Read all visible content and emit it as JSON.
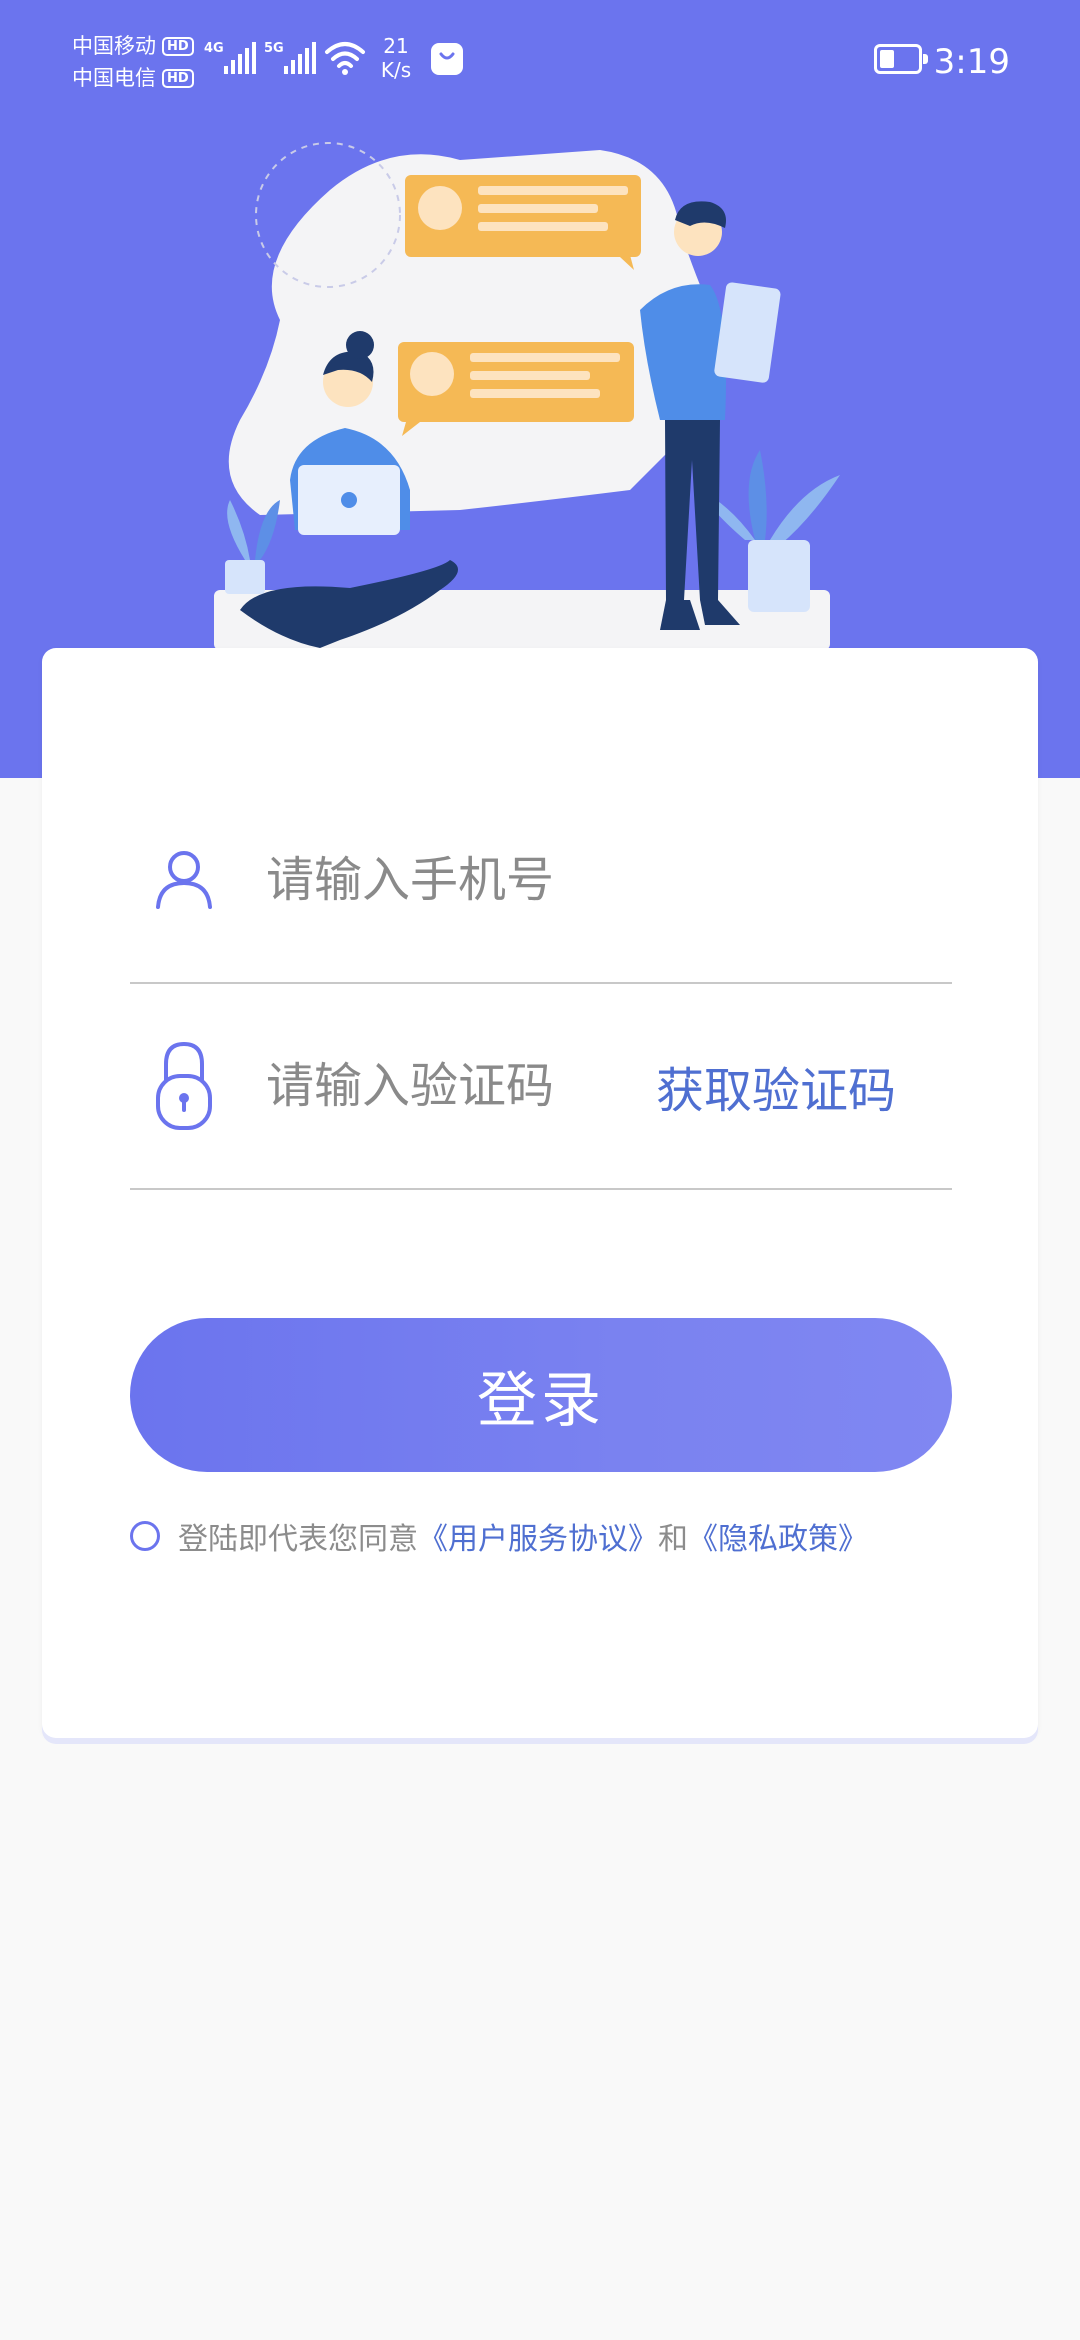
{
  "status_bar": {
    "carrier1": "中国移动",
    "carrier2": "中国电信",
    "hd": "HD",
    "net1": "4G",
    "net2": "5G",
    "speed_value": "21",
    "speed_unit": "K/s",
    "time": "3:19"
  },
  "login": {
    "phone_placeholder": "请输入手机号",
    "code_placeholder": "请输入验证码",
    "get_code_label": "获取验证码",
    "login_label": "登录",
    "agreement_prefix": "登陆即代表您同意",
    "user_agreement_link": "《用户服务协议》",
    "agreement_and": "和",
    "privacy_link": "《隐私政策》"
  },
  "colors": {
    "primary": "#6b74ee",
    "link": "#4f6fd1",
    "background": "#f9f9f9"
  },
  "icons": [
    "user-icon",
    "lock-icon",
    "wifi-icon",
    "signal-icon",
    "battery-icon",
    "shopping-bag-icon"
  ]
}
